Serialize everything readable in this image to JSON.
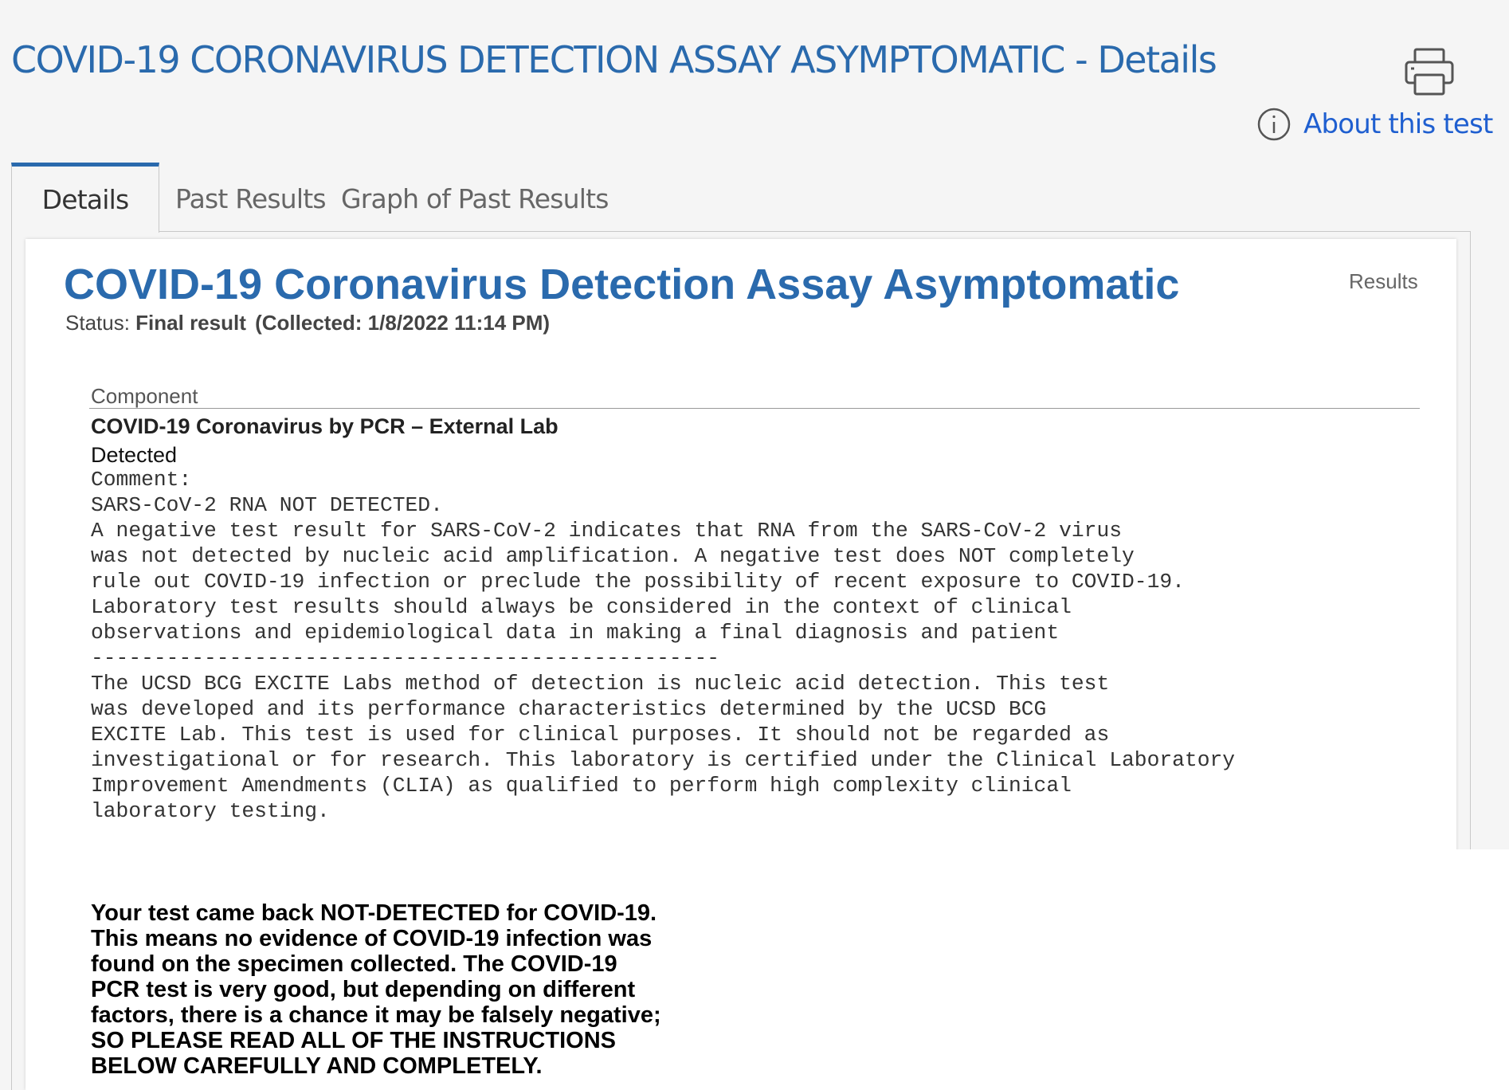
{
  "header": {
    "title": "COVID-19 CORONAVIRUS DETECTION ASSAY ASYMPTOMATIC - Details",
    "about_label": "About this test"
  },
  "icons": {
    "print": "printer-icon",
    "info": "info-icon"
  },
  "tabs": [
    {
      "label": "Details",
      "active": true
    },
    {
      "label": "Past Results",
      "active": false
    },
    {
      "label": "Graph of Past Results",
      "active": false
    }
  ],
  "report": {
    "title": "COVID-19 Coronavirus Detection Assay Asymptomatic",
    "results_label": "Results",
    "status_prefix": "Status:",
    "status_value": "Final result",
    "collected": "(Collected: 1/8/2022 11:14 PM)"
  },
  "component": {
    "header": "Component",
    "name": "COVID-19 Coronavirus by PCR – External Lab",
    "value": "Detected",
    "comment": "Comment:\nSARS-CoV-2 RNA NOT DETECTED.\nA negative test result for SARS-CoV-2 indicates that RNA from the SARS-CoV-2 virus\nwas not detected by nucleic acid amplification. A negative test does NOT completely\nrule out COVID-19 infection or preclude the possibility of recent exposure to COVID-19.\nLaboratory test results should always be considered in the context of clinical\nobservations and epidemiological data in making a final diagnosis and patient\n--------------------------------------------------\nThe UCSD BCG EXCITE Labs method of detection is nucleic acid detection. This test\nwas developed and its performance characteristics determined by the UCSD BCG\nEXCITE Lab. This test is used for clinical purposes. It should not be regarded as\ninvestigational or for research. This laboratory is certified under the Clinical Laboratory\nImprovement Amendments (CLIA) as qualified to perform high complexity clinical\nlaboratory testing."
  },
  "notice": {
    "lines": [
      "Your test came back NOT-DETECTED for COVID-19.",
      "This means no evidence of COVID-19 infection was",
      "found on the specimen collected.  The COVID-19",
      "PCR test is very good, but depending on different",
      "factors, there is a chance it may be falsely negative;",
      "SO PLEASE READ ALL OF THE INSTRUCTIONS",
      "BELOW CAREFULLY AND COMPLETELY."
    ]
  },
  "colors": {
    "accent": "#2a6aad",
    "link": "#1f5fd0",
    "background": "#f5f5f5",
    "card": "#ffffff"
  }
}
